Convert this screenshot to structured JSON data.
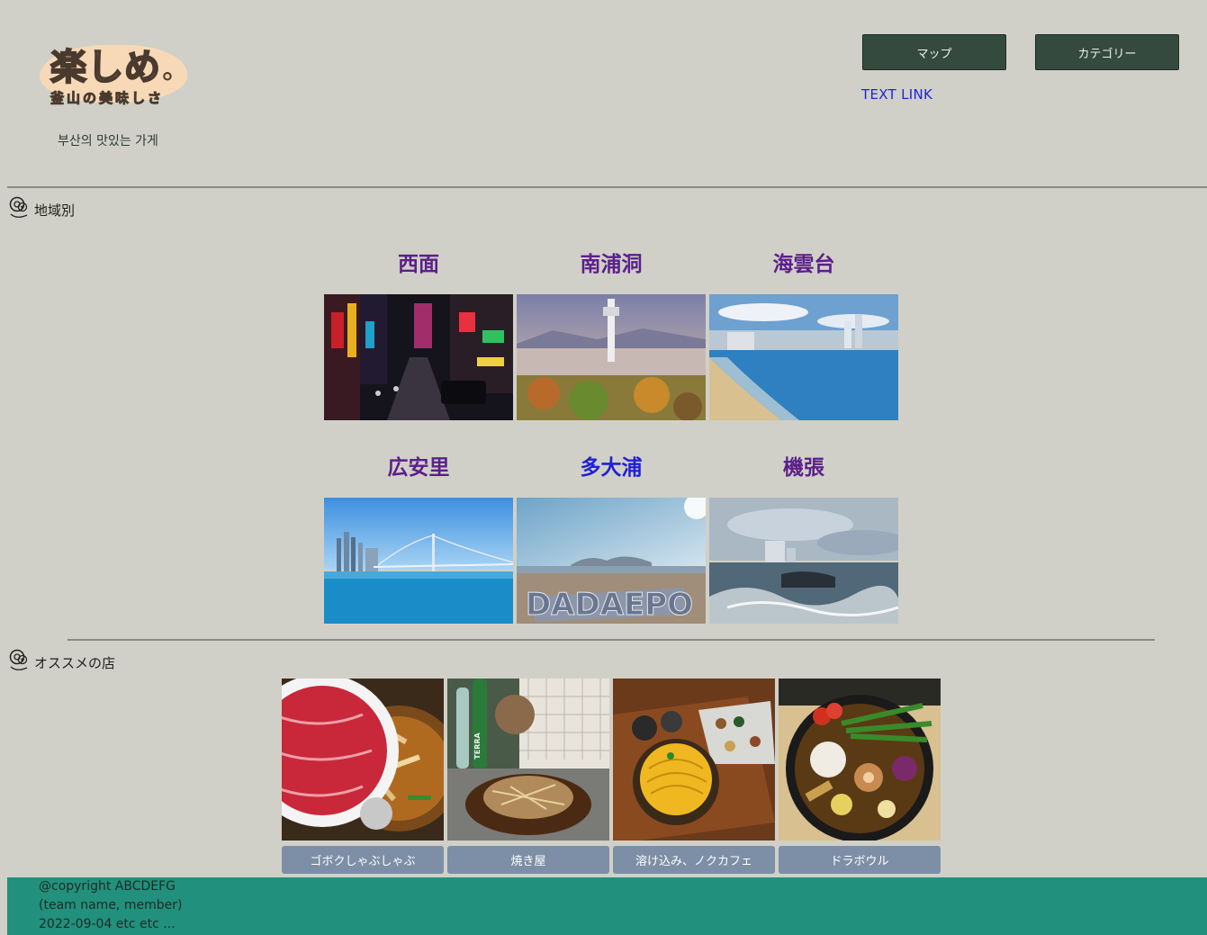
{
  "header": {
    "logo_main": "楽しめ.",
    "logo_sub": "釜山の美味しさ",
    "subtitle": "부산의 맛있는 가게",
    "nav": {
      "map_label": "マップ",
      "category_label": "カテゴリー"
    },
    "text_link": "TEXT LINK"
  },
  "regions": {
    "heading": "地域別",
    "items": [
      {
        "label": "西面"
      },
      {
        "label": "南浦洞"
      },
      {
        "label": "海雲台"
      },
      {
        "label": "広安里"
      },
      {
        "label": "多大浦"
      },
      {
        "label": "機張"
      }
    ],
    "dadaepo_sign": "DADAEPO"
  },
  "shops": {
    "heading": "オススメの店",
    "items": [
      {
        "label": "ゴボクしゃぶしゃぶ"
      },
      {
        "label": "焼き屋"
      },
      {
        "label": "溶け込み、ノクカフェ"
      },
      {
        "label": "ドラボウル"
      }
    ],
    "beer_label": "TERRA"
  },
  "footer": {
    "line1": "@copyright ABCDEFG",
    "line2": "(team name, member)",
    "line3": "2022-09-04 etc etc ..."
  },
  "colors": {
    "background": "#d0d0c8",
    "nav_button": "#344a3e",
    "region_label": "#5b1f8a",
    "region_label_active": "#2020d8",
    "shop_button": "#7d8fa6",
    "footer": "#21907c"
  }
}
